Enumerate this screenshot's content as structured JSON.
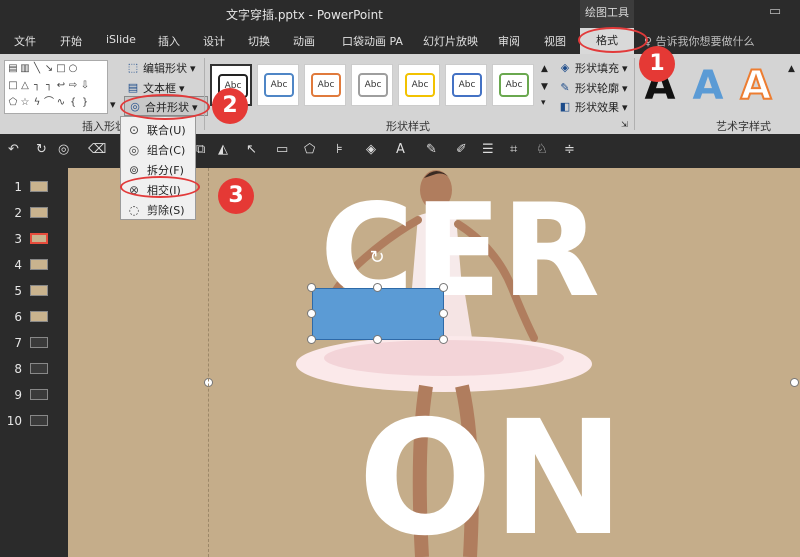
{
  "window": {
    "title": "文字穿插.pptx - PowerPoint",
    "context_tool": "绘图工具"
  },
  "tabs": [
    "文件",
    "开始",
    "iSlide",
    "插入",
    "设计",
    "切换",
    "动画",
    "口袋动画 PA",
    "幻灯片放映",
    "审阅",
    "视图"
  ],
  "active_tab": "格式",
  "tell_me": "告诉我你想要做什么",
  "ribbon": {
    "insert_shapes": {
      "label": "插入形状",
      "edit_shape": "编辑形状",
      "text_box": "文本框",
      "merge_shapes": "合并形状"
    },
    "shape_styles": {
      "label": "形状样式",
      "thumb_text": "Abc",
      "fill": "形状填充",
      "outline": "形状轮廓",
      "effects": "形状效果"
    },
    "wordart": {
      "label": "艺术字样式",
      "letter": "A"
    }
  },
  "merge_menu": [
    {
      "label": "联合(U)",
      "icon": "union-icon"
    },
    {
      "label": "组合(C)",
      "icon": "combine-icon"
    },
    {
      "label": "拆分(F)",
      "icon": "fragment-icon"
    },
    {
      "label": "相交(I)",
      "icon": "intersect-icon"
    },
    {
      "label": "剪除(S)",
      "icon": "subtract-icon"
    }
  ],
  "slides": [
    "1",
    "2",
    "3",
    "4",
    "5",
    "6",
    "7",
    "8",
    "9",
    "10"
  ],
  "active_slide": "3",
  "slide": {
    "text_line1": "CER",
    "text_line2": "ON"
  },
  "annotations": [
    "1",
    "2",
    "3"
  ],
  "colors": {
    "accent_red": "#e53935",
    "shape_blue": "#5b9bd5",
    "slide_bg": "#c5ad8a"
  }
}
